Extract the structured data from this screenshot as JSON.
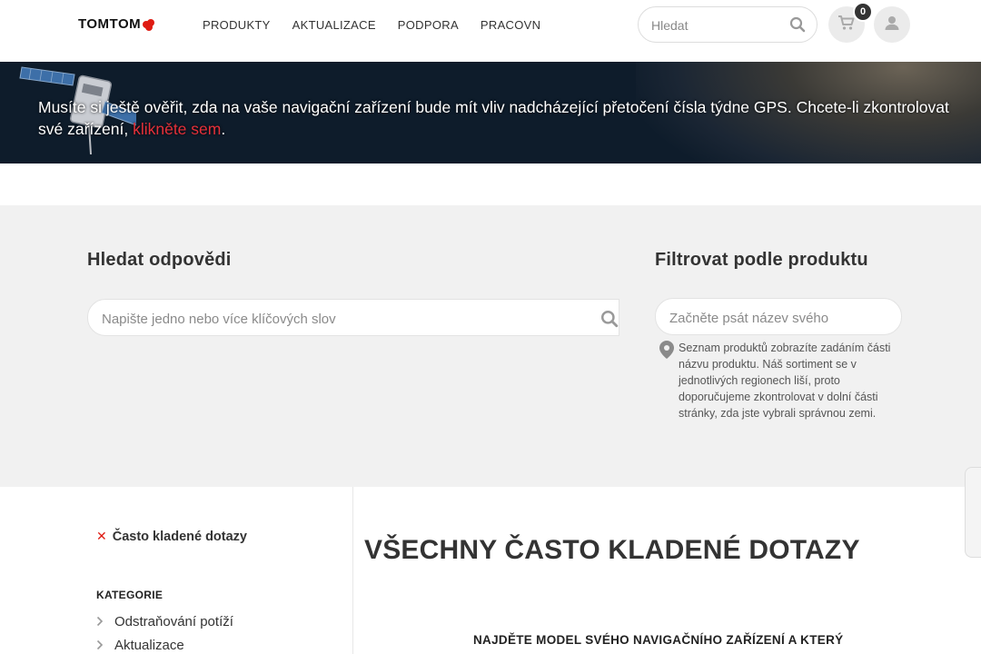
{
  "header": {
    "logo": "TOMTOM",
    "nav": [
      "PRODUKTY",
      "AKTUALIZACE",
      "PODPORA",
      "PRACOVN"
    ],
    "search_placeholder": "Hledat",
    "cart_count": "0"
  },
  "banner": {
    "text": "Musíte si ještě ověřit, zda na vaše navigační zařízení bude mít vliv nadcházející přetočení čísla týdne GPS. Chcete-li zkontrolovat své zařízení, ",
    "link": "klikněte sem",
    "after": "."
  },
  "search": {
    "title": "Hledat odpovědi",
    "placeholder": "Napište jedno nebo více klíčových slov"
  },
  "filter": {
    "title": "Filtrovat podle produktu",
    "placeholder": "Začněte psát název svého",
    "hint": "Seznam produktů zobrazíte zadáním části názvu produktu. Náš sortiment se v jednotlivých regionech liší, proto doporučujeme zkontrolovat v dolní části stránky, zda jste vybrali správnou zemi."
  },
  "sidebar": {
    "active_filter": "Často kladené dotazy",
    "categories_heading": "KATEGORIE",
    "categories": [
      "Odstraňování potíží",
      "Aktualizace"
    ]
  },
  "main": {
    "heading": "VŠECHNY ČASTO KLADENÉ DOTAZY",
    "subheading": "NAJDĚTE MODEL SVÉHO NAVIGAČNÍHO ZAŘÍZENÍ A KTERÝ"
  },
  "colors": {
    "brand_red": "#df1b12",
    "banner_bg": "#0e1c2b",
    "link_red": "#e5303a",
    "section_bg": "#f1f1f1"
  }
}
